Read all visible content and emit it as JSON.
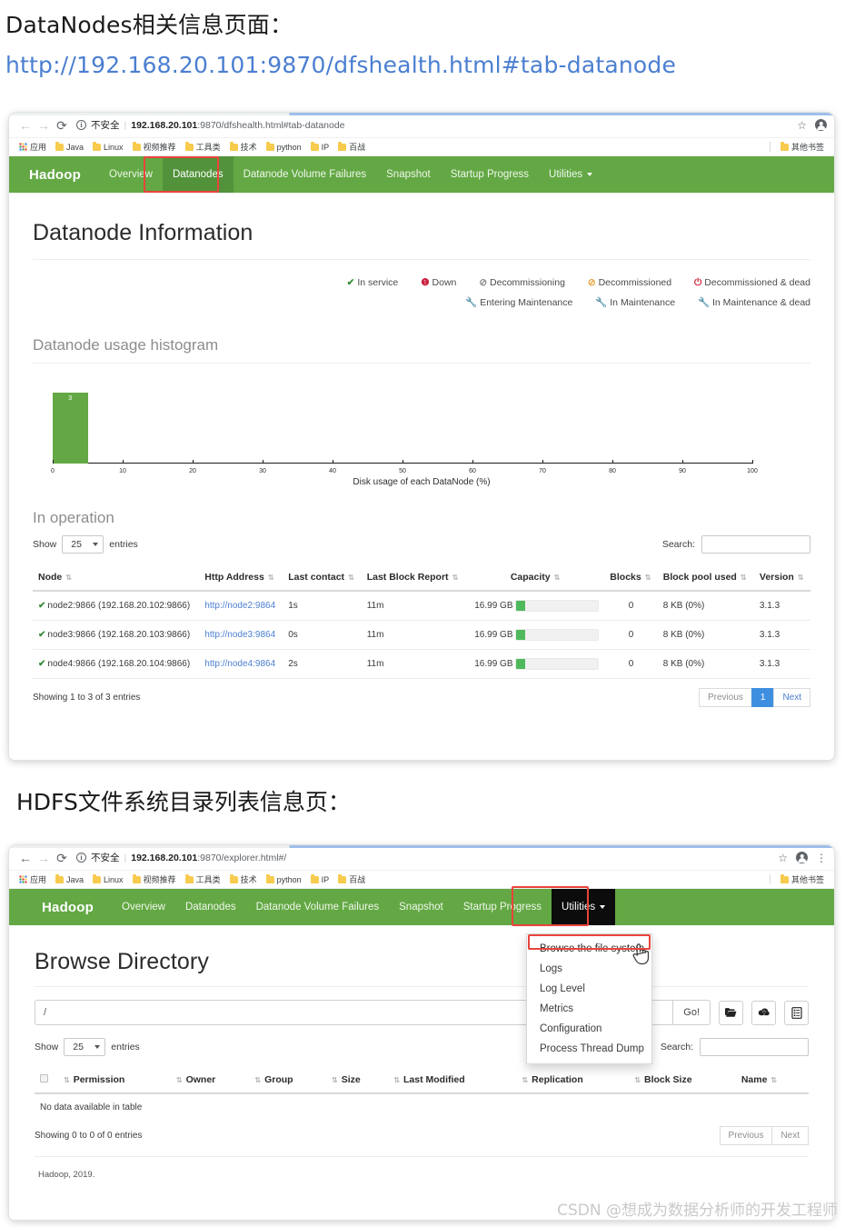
{
  "doc": {
    "heading1_prefix": "DataNodes相关信息页面：",
    "heading1_url": "http://192.168.20.101:9870/dfshealth.html#tab-datanode",
    "heading2": "HDFS文件系统目录列表信息页："
  },
  "watermark": "CSDN @想成为数据分析师的开发工程师",
  "browser1": {
    "back_icon": "back-arrow-icon",
    "forward_icon": "forward-arrow-icon",
    "reload_icon": "reload-icon",
    "security_label": "不安全",
    "url_host": "192.168.20.101",
    "url_rest": ":9870/dfshealth.html#tab-datanode",
    "star_icon": "star-icon",
    "profile_icon": "profile-avatar-icon"
  },
  "browser2": {
    "security_label": "不安全",
    "url_host": "192.168.20.101",
    "url_rest": ":9870/explorer.html#/",
    "menu_icon": "kebab-menu-icon"
  },
  "bookmarks": {
    "apps_label": "应用",
    "items": [
      "Java",
      "Linux",
      "视频推荐",
      "工具类",
      "技术",
      "python",
      "IP",
      "百战"
    ],
    "other_label": "其他书签"
  },
  "navbar": {
    "brand": "Hadoop",
    "links": [
      "Overview",
      "Datanodes",
      "Datanode Volume Failures",
      "Snapshot",
      "Startup Progress"
    ],
    "utilities": "Utilities"
  },
  "utilities_menu": {
    "items": [
      "Browse the file system",
      "Logs",
      "Log Level",
      "Metrics",
      "Configuration",
      "Process Thread Dump"
    ]
  },
  "datanode_page": {
    "title": "Datanode Information",
    "legend_row1": [
      {
        "icon": "✔",
        "label": "In service",
        "color_class": "lg-green"
      },
      {
        "icon": "!",
        "label": "Down",
        "color_class": "lg-red"
      },
      {
        "icon": "⊘",
        "label": "Decommissioning",
        "color_class": "lg-gray"
      },
      {
        "icon": "⊘",
        "label": "Decommissioned",
        "color_class": "lg-orange"
      },
      {
        "icon": "⏻",
        "label": "Decommissioned & dead",
        "color_class": "lg-redd"
      }
    ],
    "legend_row2": [
      {
        "icon": "🔧",
        "label": "Entering Maintenance",
        "color_class": "lg-green"
      },
      {
        "icon": "🔧",
        "label": "In Maintenance",
        "color_class": "lg-orange"
      },
      {
        "icon": "🔧",
        "label": "In Maintenance & dead",
        "color_class": "lg-pink"
      }
    ],
    "histogram_title": "Datanode usage histogram",
    "in_operation_title": "In operation",
    "show_label": "Show",
    "show_value": "25",
    "entries_label": "entries",
    "search_label": "Search:",
    "columns": [
      "Node",
      "Http Address",
      "Last contact",
      "Last Block Report",
      "Capacity",
      "Blocks",
      "Block pool used",
      "Version"
    ],
    "rows": [
      {
        "node": "node2:9866 (192.168.20.102:9866)",
        "http_address": "http://node2:9864",
        "last_contact": "1s",
        "last_block_report": "11m",
        "capacity": "16.99 GB",
        "capacity_pct": 11,
        "blocks": "0",
        "block_pool_used": "8 KB (0%)",
        "version": "3.1.3"
      },
      {
        "node": "node3:9866 (192.168.20.103:9866)",
        "http_address": "http://node3:9864",
        "last_contact": "0s",
        "last_block_report": "11m",
        "capacity": "16.99 GB",
        "capacity_pct": 11,
        "blocks": "0",
        "block_pool_used": "8 KB (0%)",
        "version": "3.1.3"
      },
      {
        "node": "node4:9866 (192.168.20.104:9866)",
        "http_address": "http://node4:9864",
        "last_contact": "2s",
        "last_block_report": "11m",
        "capacity": "16.99 GB",
        "capacity_pct": 11,
        "blocks": "0",
        "block_pool_used": "8 KB (0%)",
        "version": "3.1.3"
      }
    ],
    "showing_info": "Showing 1 to 3 of 3 entries",
    "pager": {
      "previous": "Previous",
      "page": "1",
      "next": "Next"
    }
  },
  "explorer_page": {
    "title": "Browse Directory",
    "path_value": "/",
    "go_label": "Go!",
    "buttons": [
      "folder-open-icon",
      "cloud-upload-icon",
      "clipboard-list-icon"
    ],
    "show_label": "Show",
    "show_value": "25",
    "entries_label": "entries",
    "search_label": "Search:",
    "columns": [
      "Permission",
      "Owner",
      "Group",
      "Size",
      "Last Modified",
      "Replication",
      "Block Size",
      "Name"
    ],
    "empty_text": "No data available in table",
    "showing_info": "Showing 0 to 0 of 0 entries",
    "pager": {
      "previous": "Previous",
      "next": "Next"
    },
    "footer": "Hadoop, 2019."
  },
  "chart_data": {
    "type": "bar",
    "title": "Datanode usage histogram",
    "xlabel": "Disk usage of each DataNode (%)",
    "ylabel": "",
    "categories": [
      "0-5",
      "5-10",
      "10-15",
      "15-20",
      "20-25",
      "25-30",
      "30-35",
      "35-40",
      "40-45",
      "45-50",
      "50-55",
      "55-60",
      "60-65",
      "65-70",
      "70-75",
      "75-80",
      "80-85",
      "85-90",
      "90-95",
      "95-100"
    ],
    "values": [
      3,
      0,
      0,
      0,
      0,
      0,
      0,
      0,
      0,
      0,
      0,
      0,
      0,
      0,
      0,
      0,
      0,
      0,
      0,
      0
    ],
    "bar_labels": [
      "3"
    ],
    "xlim": [
      0,
      100
    ],
    "ylim": [
      0,
      3
    ],
    "xticks": [
      0,
      10,
      20,
      30,
      40,
      50,
      60,
      70,
      80,
      90,
      100
    ],
    "grid": false,
    "legend": false,
    "bar_color": "#63a844"
  },
  "colors": {
    "hadoop_green": "#63a844",
    "hadoop_green_active": "#52923a",
    "link_blue": "#4b7fd1",
    "accent_red": "#e8443a",
    "capacity_green": "#4fba5c"
  }
}
